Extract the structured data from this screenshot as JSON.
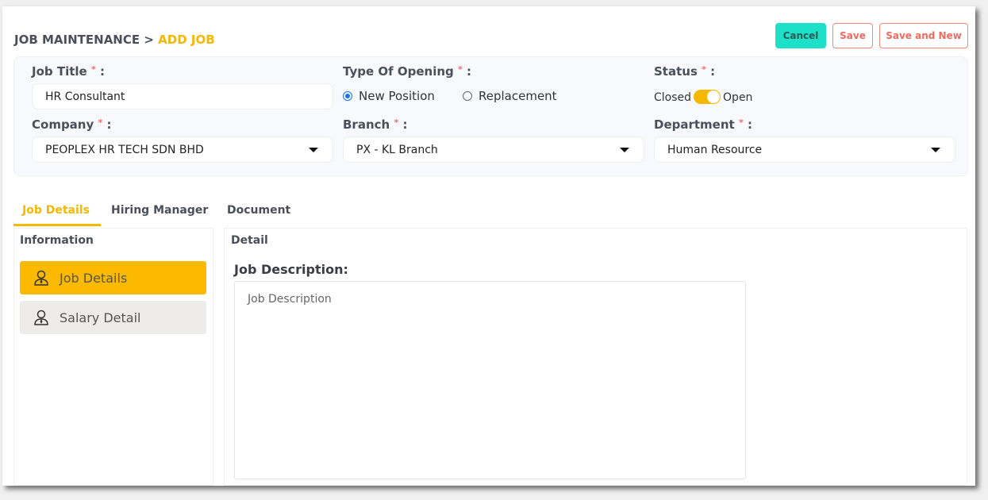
{
  "breadcrumb": {
    "parent": "JOB MAINTENANCE",
    "separator": ">",
    "current": "ADD JOB"
  },
  "buttons": {
    "cancel": "Cancel",
    "save": "Save",
    "save_new": "Save and New"
  },
  "form": {
    "job_title": {
      "label": "Job Title",
      "value": "HR Consultant"
    },
    "type_of_opening": {
      "label": "Type Of Opening",
      "options": [
        "New Position",
        "Replacement"
      ],
      "selected": "New Position"
    },
    "status": {
      "label": "Status",
      "off_label": "Closed",
      "on_label": "Open",
      "value": "Open"
    },
    "company": {
      "label": "Company",
      "value": "PEOPLEX HR TECH SDN BHD"
    },
    "branch": {
      "label": "Branch",
      "value": "PX - KL Branch"
    },
    "department": {
      "label": "Department",
      "value": "Human Resource"
    },
    "required_mark": "*",
    "colon": ":"
  },
  "tabs": [
    "Job Details",
    "Hiring Manager",
    "Document"
  ],
  "left_panel": {
    "title": "Information",
    "items": [
      {
        "label": "Job Details",
        "icon": "user-tie-icon",
        "active": true
      },
      {
        "label": "Salary Detail",
        "icon": "user-tie-icon",
        "active": false
      }
    ]
  },
  "right_panel": {
    "title": "Detail",
    "field_label": "Job Description:",
    "placeholder": "Job Description"
  },
  "colors": {
    "accent": "#f5b800",
    "cancel": "#1de0c8",
    "danger": "#ee6a5e"
  }
}
